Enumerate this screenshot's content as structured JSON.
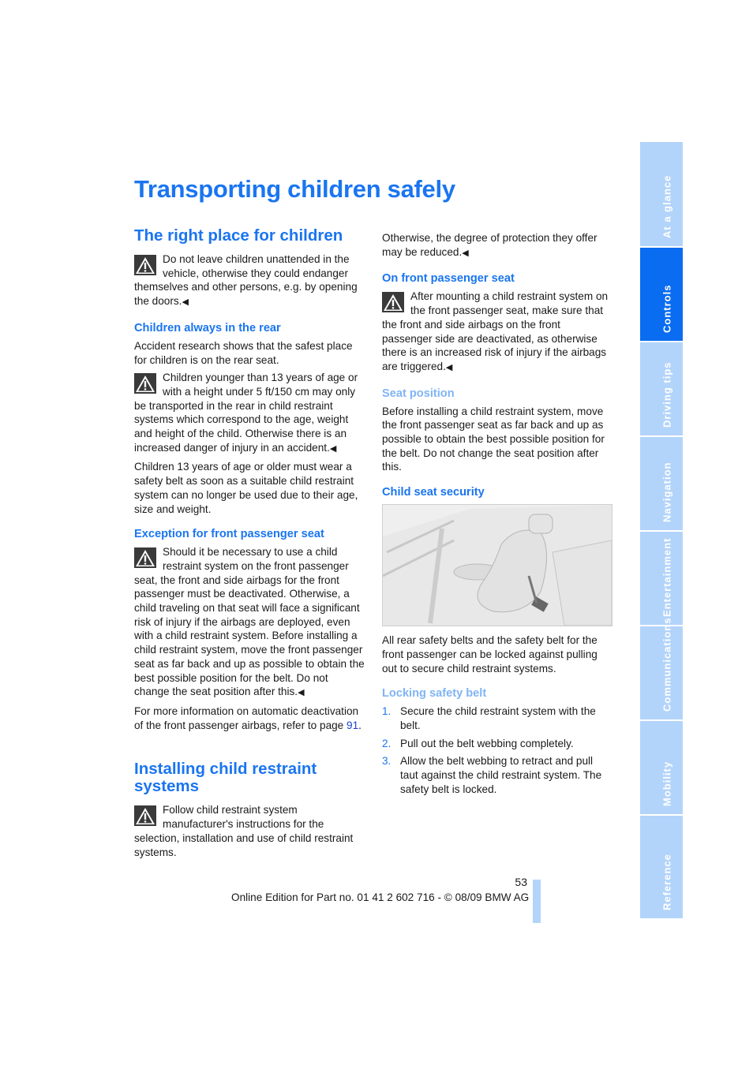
{
  "page": {
    "title": "Transporting children safely",
    "page_number": "53",
    "footer": "Online Edition for Part no. 01 41 2 602 716 - © 08/09 BMW AG"
  },
  "sidebar": {
    "tabs": [
      {
        "label": "At a glance",
        "active": false
      },
      {
        "label": "Controls",
        "active": true
      },
      {
        "label": "Driving tips",
        "active": false
      },
      {
        "label": "Navigation",
        "active": false
      },
      {
        "label": "Entertainment",
        "active": false
      },
      {
        "label": "Communications",
        "active": false
      },
      {
        "label": "Mobility",
        "active": false
      },
      {
        "label": "Reference",
        "active": false
      }
    ]
  },
  "left": {
    "h_right_place": "The right place for children",
    "warn1": "Do not leave children unattended in the vehicle, otherwise they could endanger themselves and other persons, e.g. by opening the doors.",
    "h_rear": "Children always in the rear",
    "p_rear": "Accident research shows that the safest place for children is on the rear seat.",
    "warn2": "Children younger than 13 years of age or with a height under 5 ft/150 cm may only be transported in the rear in child restraint systems which correspond to the age, weight and height of the child. Otherwise there is an increased danger of injury in an accident.",
    "p_13": "Children 13 years of age or older must wear a safety belt as soon as a suitable child restraint system can no longer be used due to their age, size and weight.",
    "h_exception": "Exception for front passenger seat",
    "warn3": "Should it be necessary to use a child restraint system on the front passenger seat, the front and side airbags for the front passenger must be deactivated. Otherwise, a child traveling on that seat will face a significant risk of injury if the airbags are deployed, even with a child restraint system. Before installing a child restraint system, move the front passenger seat as far back and up as possible to obtain the best possible position for the belt. Do not change the seat position after this.",
    "p_more": "For more information on automatic deactivation of the front passenger airbags, refer to page ",
    "p_more_link": "91",
    "h_installing": "Installing child restraint systems",
    "warn4": "Follow child restraint system manufacturer's instructions for the selection, installation and use of child restraint systems."
  },
  "right": {
    "p_otherwise": "Otherwise, the degree of protection they offer may be reduced.",
    "h_front": "On front passenger seat",
    "warn5": "After mounting a child restraint system on the front passenger seat, make sure that the front and side airbags on the front passenger side are deactivated, as otherwise there is an increased risk of injury if the airbags are triggered.",
    "h_seat_pos": "Seat position",
    "p_seat_pos": "Before installing a child restraint system, move the front passenger seat as far back and up as possible to obtain the best possible position for the belt. Do not change the seat position after this.",
    "h_security": "Child seat security",
    "p_security": "All rear safety belts and the safety belt for the front passenger can be locked against pulling out to secure child restraint systems.",
    "h_locking": "Locking safety belt",
    "steps": [
      {
        "num": "1.",
        "text": "Secure the child restraint system with the belt."
      },
      {
        "num": "2.",
        "text": "Pull out the belt webbing completely."
      },
      {
        "num": "3.",
        "text": "Allow the belt webbing to retract and pull taut against the child restraint system. The safety belt is locked."
      }
    ],
    "end_mark": "◀"
  }
}
